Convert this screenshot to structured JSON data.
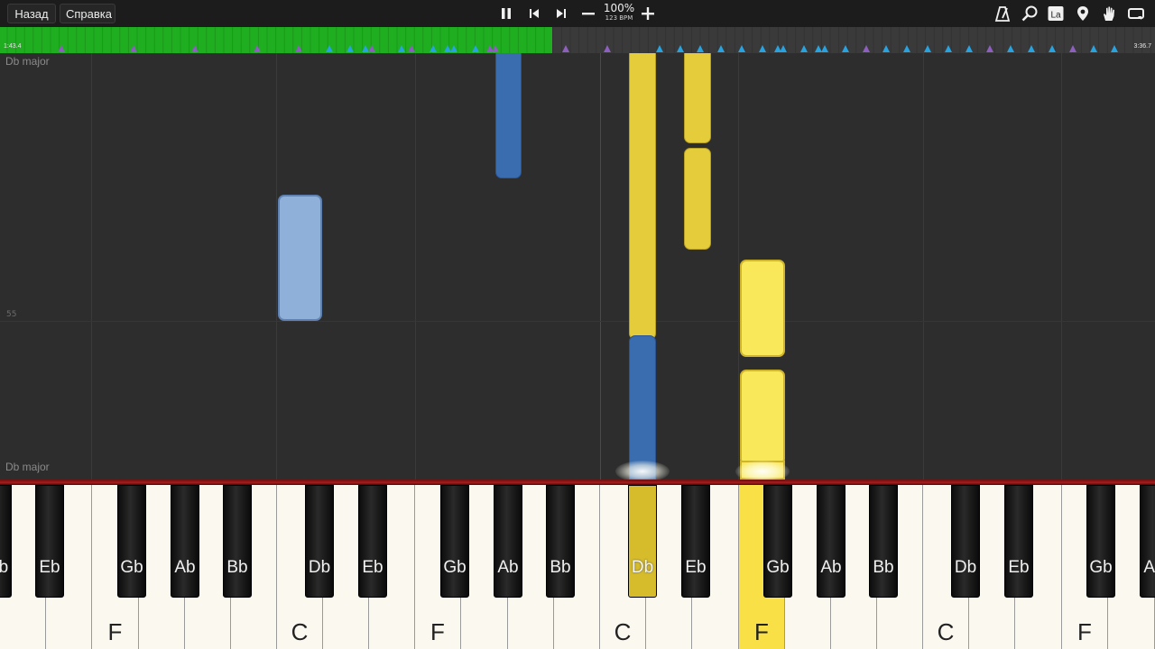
{
  "toolbar": {
    "back_label": "Назад",
    "help_label": "Справка",
    "tempo_percent": "100%",
    "tempo_bpm": "123 BPM",
    "icons": [
      "pause-icon",
      "previous-icon",
      "next-icon",
      "minus-icon",
      "plus-icon",
      "metronome-icon",
      "search-icon",
      "label-icon",
      "location-pin-icon",
      "hand-icon",
      "loop-icon"
    ],
    "label_icon_text": "La"
  },
  "timeline": {
    "time_start": "1:43.4",
    "time_end": "3:36.7",
    "progress": 0.478,
    "progress_color": "#1fae1f"
  },
  "roll": {
    "key_signature_top": "Db major",
    "key_signature_bottom": "Db major",
    "bar_number": "55"
  },
  "keyboard": {
    "white_labels": [
      "F",
      "C",
      "F",
      "C",
      "F",
      "C",
      "F"
    ],
    "black_labels": [
      "Db",
      "Eb",
      "Gb",
      "Ab",
      "Bb",
      "Db",
      "Eb",
      "Gb",
      "Ab",
      "Bb",
      "Db",
      "Eb",
      "Gb",
      "Ab",
      "Bb",
      "Db",
      "Eb",
      "Gb",
      "Ab"
    ],
    "pressed_white": "F",
    "pressed_black": "Db"
  },
  "colors": {
    "left_hand": "#3a6db0",
    "right_hand": "#e4cc3a",
    "timeline_progress": "#1fae1f"
  }
}
